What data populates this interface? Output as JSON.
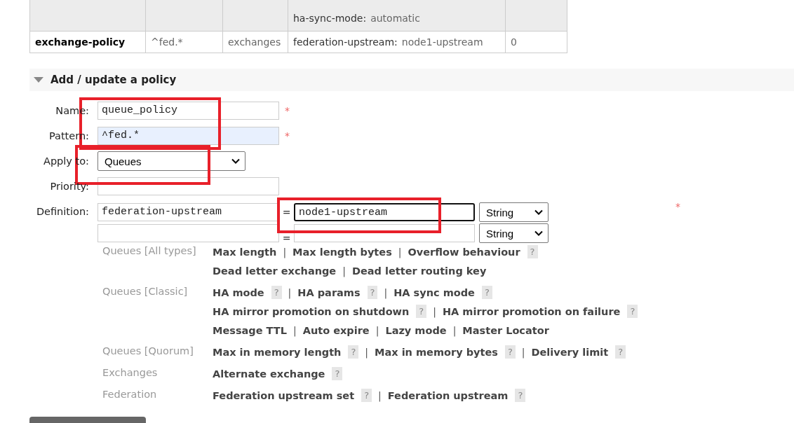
{
  "policies_table": {
    "rows": [
      {
        "definition": [
          {
            "key": "ha-sync-mode:",
            "value": "automatic"
          }
        ]
      },
      {
        "name": "exchange-policy",
        "pattern": "^fed.*",
        "apply_to": "exchanges",
        "definition": [
          {
            "key": "federation-upstream:",
            "value": "node1-upstream"
          }
        ],
        "priority": "0"
      }
    ]
  },
  "policy_form": {
    "title": "Add / update a policy",
    "expanded": true,
    "required_mark": "*",
    "fields": [
      {
        "kind": "text",
        "label": "Name:",
        "value": "queue_policy",
        "required": true,
        "autofilled": false
      },
      {
        "kind": "text",
        "label": "Pattern:",
        "value": "^fed.*",
        "required": true,
        "autofilled": true
      },
      {
        "kind": "select",
        "label": "Apply to:",
        "value": "Queues",
        "required": false
      },
      {
        "kind": "text",
        "label": "Priority:",
        "required": false,
        "autofilled": false
      }
    ],
    "definition": {
      "label": "Definition:",
      "required": true,
      "assign": "=",
      "rows": [
        {
          "key": "federation-upstream",
          "value": "node1-upstream",
          "type": "String",
          "focused": true
        },
        {
          "type": "String",
          "focused": false
        }
      ]
    },
    "help_mark": "?",
    "separator": "|",
    "help_groups": [
      {
        "label": "Queues [All types]",
        "lines": [
          [
            {
              "text": "Max length",
              "help": false
            },
            {
              "text": "Max length bytes",
              "help": false
            },
            {
              "text": "Overflow behaviour",
              "help": true
            }
          ],
          [
            {
              "text": "Dead letter exchange",
              "help": false
            },
            {
              "text": "Dead letter routing key",
              "help": false
            }
          ]
        ]
      },
      {
        "label": "Queues [Classic]",
        "lines": [
          [
            {
              "text": "HA mode",
              "help": true
            },
            {
              "text": "HA params",
              "help": true
            },
            {
              "text": "HA sync mode",
              "help": true
            }
          ],
          [
            {
              "text": "HA mirror promotion on shutdown",
              "help": true
            },
            {
              "text": "HA mirror promotion on failure",
              "help": true
            }
          ],
          [
            {
              "text": "Message TTL",
              "help": false
            },
            {
              "text": "Auto expire",
              "help": false
            },
            {
              "text": "Lazy mode",
              "help": false
            },
            {
              "text": "Master Locator",
              "help": false
            }
          ]
        ]
      },
      {
        "label": "Queues [Quorum]",
        "lines": [
          [
            {
              "text": "Max in memory length",
              "help": true
            },
            {
              "text": "Max in memory bytes",
              "help": true
            },
            {
              "text": "Delivery limit",
              "help": true
            }
          ]
        ]
      },
      {
        "label": "Exchanges",
        "lines": [
          [
            {
              "text": "Alternate exchange",
              "help": true
            }
          ]
        ]
      },
      {
        "label": "Federation",
        "lines": [
          [
            {
              "text": "Federation upstream set",
              "help": true
            },
            {
              "text": "Federation upstream",
              "help": true
            }
          ]
        ]
      }
    ]
  },
  "highlight_boxes": [
    {
      "kind": "rectangle"
    },
    {
      "kind": "rectangle"
    },
    {
      "kind": "rectangle"
    }
  ]
}
